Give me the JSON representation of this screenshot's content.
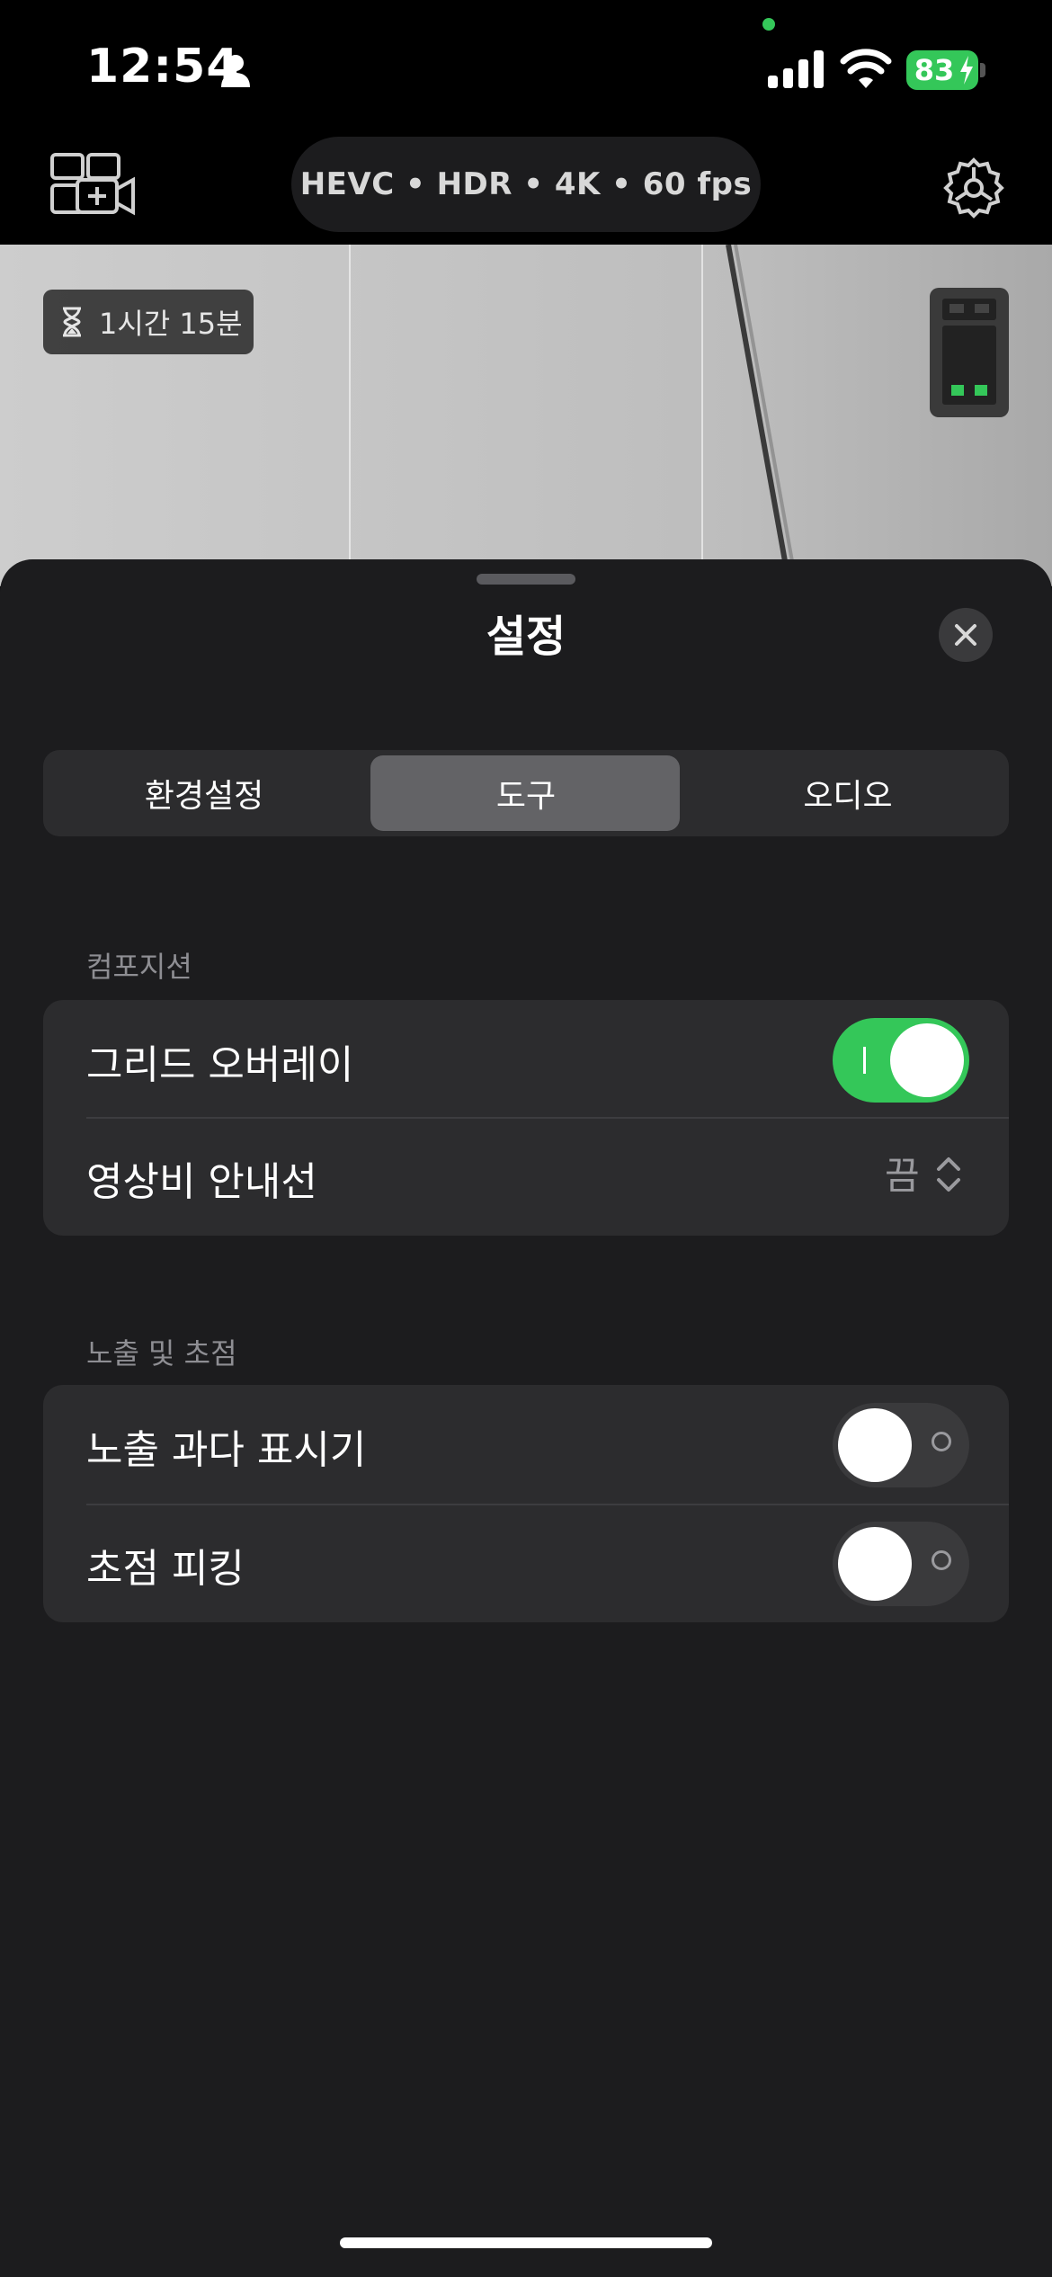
{
  "status_bar": {
    "time": "12:54",
    "battery": "83"
  },
  "camera_bar": {
    "format": "HEVC • HDR • 4K • 60 fps"
  },
  "viewfinder": {
    "remaining_time": "1시간 15분"
  },
  "sheet": {
    "title": "설정",
    "tabs": [
      {
        "label": "환경설정",
        "selected": false
      },
      {
        "label": "도구",
        "selected": true
      },
      {
        "label": "오디오",
        "selected": false
      }
    ],
    "sections": [
      {
        "header": "컴포지션",
        "rows": [
          {
            "label": "그리드 오버레이",
            "type": "toggle",
            "on": true
          },
          {
            "label": "영상비 안내선",
            "type": "popup",
            "value": "끔"
          }
        ]
      },
      {
        "header": "노출 및 초점",
        "rows": [
          {
            "label": "노출 과다 표시기",
            "type": "toggle",
            "on": false
          },
          {
            "label": "초점 피킹",
            "type": "toggle",
            "on": false
          }
        ]
      }
    ]
  },
  "colors": {
    "accent_green": "#34c759",
    "sheet_bg": "#1c1c1e",
    "group_bg": "#2c2c2e"
  },
  "icons": [
    "person-icon",
    "signal-icon",
    "wifi-icon",
    "bolt-icon",
    "multicam-add-icon",
    "gear-icon",
    "hourglass-icon",
    "storage-icon",
    "close-icon",
    "chevron-updown-icon"
  ]
}
